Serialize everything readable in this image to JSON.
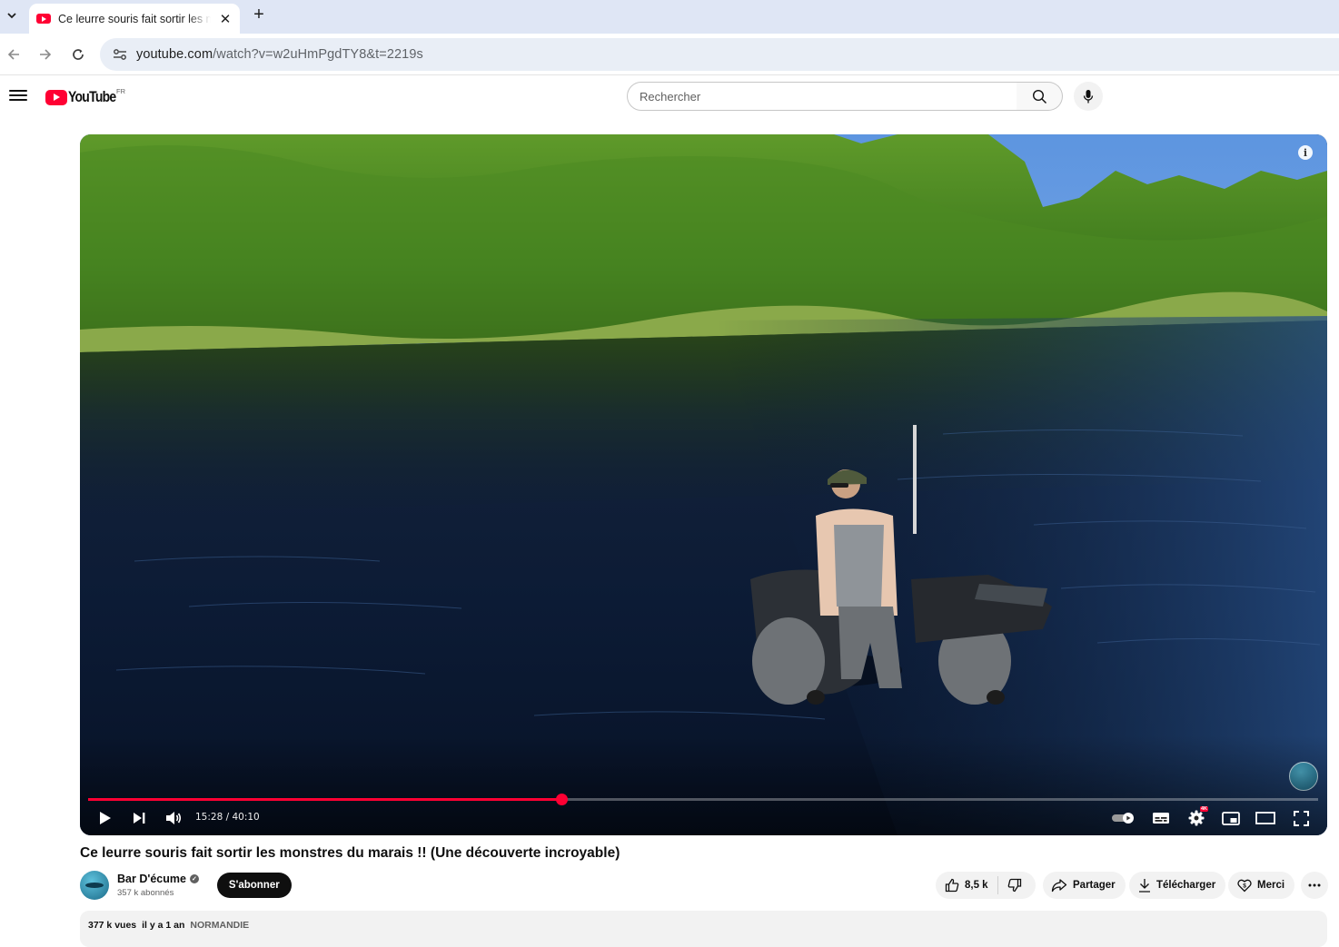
{
  "browser": {
    "tab": {
      "title": "Ce leurre souris fait sortir les monstres du marais !! (Une découverte incroyable) - YouTube"
    },
    "address": {
      "host": "youtube.com",
      "path": "/watch?v=w2uHmPgdTY8&t=2219s"
    }
  },
  "youtube": {
    "logo_text": "YouTube",
    "country_code": "FR",
    "search": {
      "placeholder": "Rechercher",
      "value": ""
    }
  },
  "player": {
    "current_time": "15:28",
    "duration": "40:10",
    "time_display": "15:28 / 40:10",
    "progress_fraction": 0.385,
    "quality_badge": "4K",
    "accent_color": "#ff0033"
  },
  "video": {
    "title": "Ce leurre souris fait sortir les monstres du marais !! (Une découverte incroyable)",
    "channel": {
      "name": "Bar D'écume",
      "subscribers": "357 k abonnés"
    },
    "subscribe_label": "S'abonner",
    "likes": "8,5 k",
    "share_label": "Partager",
    "download_label": "Télécharger",
    "thanks_label": "Merci",
    "views": "377 k vues",
    "age": "il y a 1 an",
    "hashtag": "NORMANDIE"
  }
}
